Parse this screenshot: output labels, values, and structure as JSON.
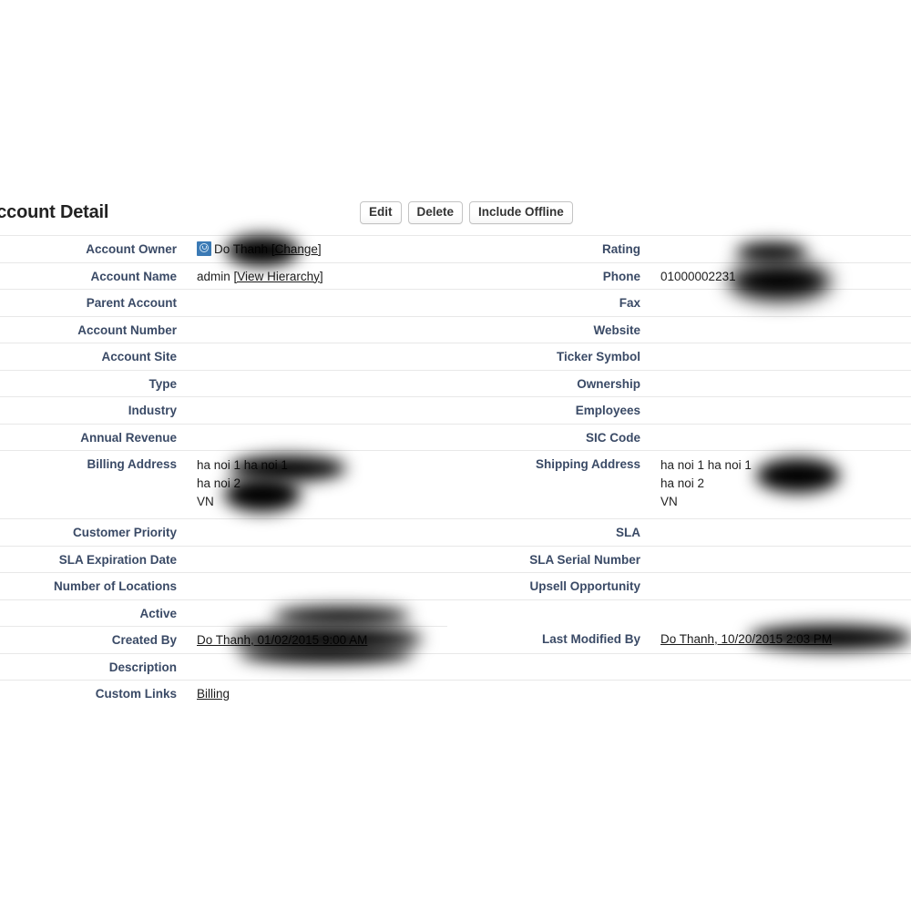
{
  "panel": {
    "title": "Account Detail",
    "buttons": [
      {
        "label": "Edit",
        "name": "edit-button"
      },
      {
        "label": "Delete",
        "name": "delete-button"
      },
      {
        "label": "Include Offline",
        "name": "include-offline-button"
      }
    ]
  },
  "colors": {
    "label_text": "#3a4a66",
    "value_text": "#222222",
    "row_divider": "#e8e8e8",
    "avatar_blue": "#3b7ab5",
    "page_background": "#ffffff",
    "button_border": "#c4c4c4"
  },
  "fields": {
    "account_owner": {
      "label": "Account Owner",
      "value": "Do Thanh",
      "change_link": "[Change]",
      "icon": "user-avatar-icon",
      "redacted": true
    },
    "account_name": {
      "label": "Account Name",
      "value": "admin",
      "hierarchy_link": "[View Hierarchy]"
    },
    "parent_account": {
      "label": "Parent Account",
      "value": ""
    },
    "account_number": {
      "label": "Account Number",
      "value": ""
    },
    "account_site": {
      "label": "Account Site",
      "value": ""
    },
    "type": {
      "label": "Type",
      "value": ""
    },
    "industry": {
      "label": "Industry",
      "value": ""
    },
    "annual_revenue": {
      "label": "Annual Revenue",
      "value": ""
    },
    "billing_address": {
      "label": "Billing Address",
      "line1": "ha noi 1 ha noi 1",
      "line2": "ha noi 2",
      "line3": "VN",
      "redacted": true
    },
    "customer_priority": {
      "label": "Customer Priority",
      "value": ""
    },
    "sla_expiration_date": {
      "label": "SLA Expiration Date",
      "value": ""
    },
    "number_of_locations": {
      "label": "Number of Locations",
      "value": ""
    },
    "active": {
      "label": "Active",
      "value": ""
    },
    "created_by": {
      "label": "Created By",
      "value": "Do Thanh, 01/02/2015 9:00 AM",
      "redacted": true
    },
    "description": {
      "label": "Description",
      "value": ""
    },
    "custom_links": {
      "label": "Custom Links",
      "value": "Billing"
    },
    "rating": {
      "label": "Rating",
      "value": "",
      "redacted": true
    },
    "phone": {
      "label": "Phone",
      "value": "01000002231",
      "redacted": true
    },
    "fax": {
      "label": "Fax",
      "value": ""
    },
    "website": {
      "label": "Website",
      "value": ""
    },
    "ticker_symbol": {
      "label": "Ticker Symbol",
      "value": ""
    },
    "ownership": {
      "label": "Ownership",
      "value": ""
    },
    "employees": {
      "label": "Employees",
      "value": ""
    },
    "sic_code": {
      "label": "SIC Code",
      "value": ""
    },
    "shipping_address": {
      "label": "Shipping Address",
      "line1": "ha noi 1 ha noi 1",
      "line2": "ha noi 2",
      "line3": "VN",
      "redacted": true
    },
    "sla": {
      "label": "SLA",
      "value": ""
    },
    "sla_serial_number": {
      "label": "SLA Serial Number",
      "value": ""
    },
    "upsell_opportunity": {
      "label": "Upsell Opportunity",
      "value": ""
    },
    "last_modified_by": {
      "label": "Last Modified By",
      "value": "Do Thanh, 10/20/2015 2:03 PM",
      "redacted": true
    }
  }
}
